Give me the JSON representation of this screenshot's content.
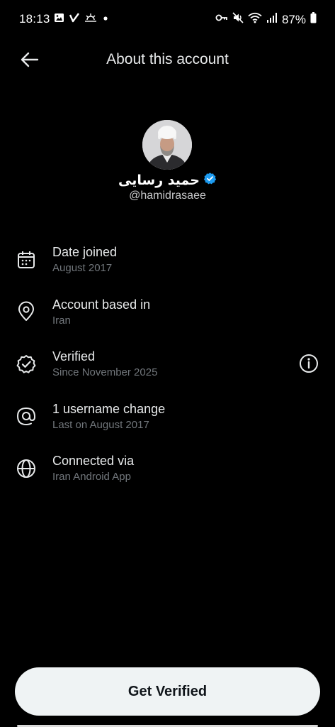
{
  "status_bar": {
    "time": "18:13",
    "battery": "87%",
    "left_icons": [
      "gallery-icon",
      "check-v-icon",
      "sunrise-icon",
      "dot-icon"
    ],
    "right_icons": [
      "key-icon",
      "mute-icon",
      "wifi-icon",
      "signal-icon",
      "battery-icon"
    ]
  },
  "header": {
    "title": "About this account",
    "back_icon": "arrow-left-icon"
  },
  "profile": {
    "display_name": "حمید رسایی",
    "handle": "@hamidrasaee",
    "verified_badge_color": "#1d9bf0"
  },
  "info_rows": [
    {
      "icon": "calendar-icon",
      "title": "Date joined",
      "subtitle": "August 2017"
    },
    {
      "icon": "location-pin-icon",
      "title": "Account based in",
      "subtitle": "Iran"
    },
    {
      "icon": "verified-badge-icon",
      "title": "Verified",
      "subtitle": "Since November 2025",
      "info_icon": "info-icon"
    },
    {
      "icon": "at-sign-icon",
      "title": "1 username change",
      "subtitle": "Last on August 2017"
    },
    {
      "icon": "globe-icon",
      "title": "Connected via",
      "subtitle": "Iran Android App"
    }
  ],
  "footer": {
    "button_label": "Get Verified"
  },
  "colors": {
    "background": "#000000",
    "primary_text": "#e7e9ea",
    "secondary_text": "#71767b",
    "button_bg": "#eff3f4",
    "button_text": "#0f1419"
  }
}
